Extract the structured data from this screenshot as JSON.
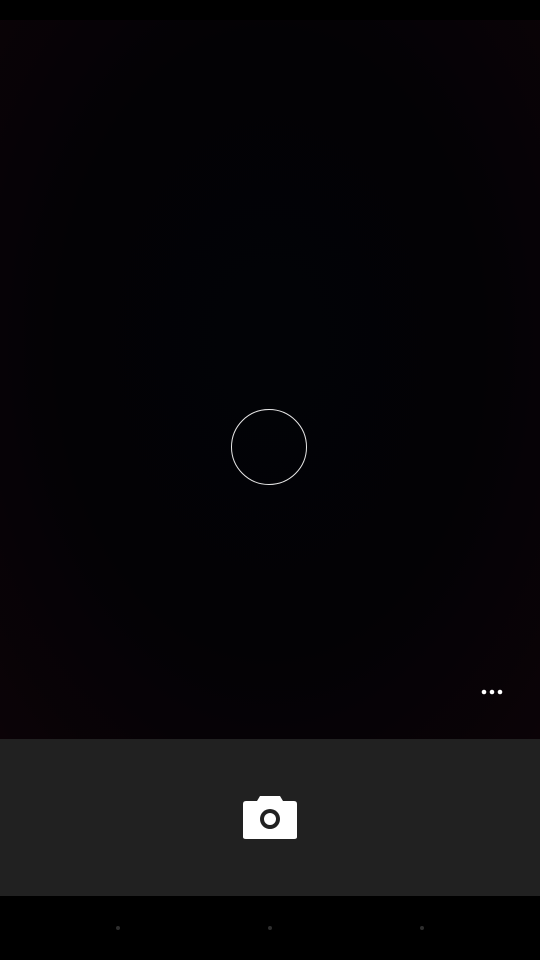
{
  "app": {
    "name": "Camera"
  },
  "viewfinder": {
    "focus_indicator": "focus-ring",
    "more_options_icon": "more-horizontal-icon"
  },
  "controls": {
    "shutter_icon": "camera-icon",
    "panel_color": "#212121"
  },
  "navigation": {
    "items": [
      {
        "icon": "back-icon"
      },
      {
        "icon": "home-icon"
      },
      {
        "icon": "recents-icon"
      }
    ]
  },
  "colors": {
    "background": "#000000",
    "icon": "#ffffff",
    "nav_icon": "#2e2e2e"
  }
}
